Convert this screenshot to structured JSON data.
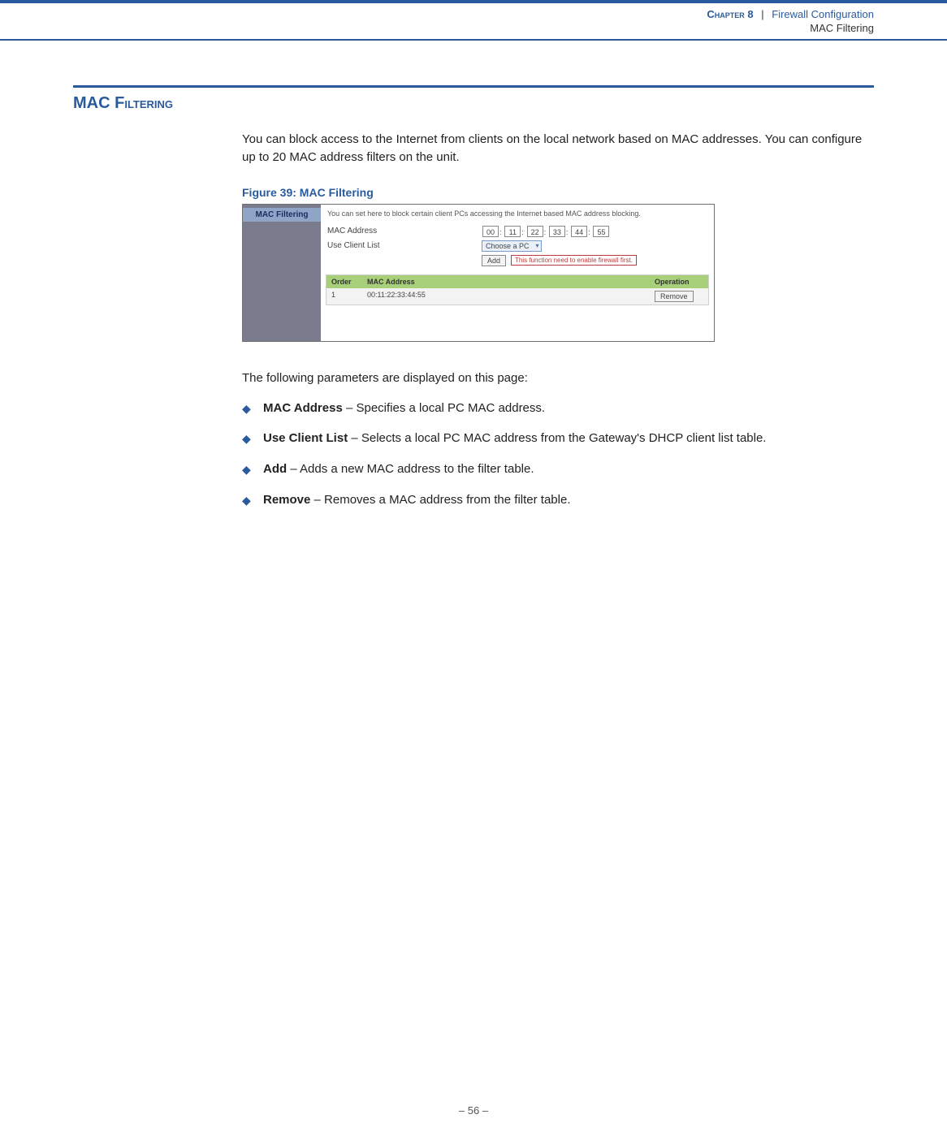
{
  "header": {
    "chapter_label": "Chapter 8",
    "separator": "|",
    "title": "Firewall Configuration",
    "subsection": "MAC Filtering"
  },
  "section": {
    "heading_main": "MAC F",
    "heading_rest": "iltering",
    "intro": "You can block access to the Internet from clients on the local network based on MAC addresses. You can configure up to 20 MAC address filters on the unit.",
    "figure_caption": "Figure 39:  MAC Filtering",
    "params_intro": "The following parameters are displayed on this page:",
    "params": [
      {
        "term": "MAC Address",
        "desc": " – Specifies a local PC MAC address."
      },
      {
        "term": "Use Client List",
        "desc": " – Selects a local PC MAC address from the Gateway's DHCP client list table."
      },
      {
        "term": "Add",
        "desc": " – Adds a new MAC address to the filter table."
      },
      {
        "term": "Remove",
        "desc": " – Removes a MAC address from the filter table."
      }
    ]
  },
  "screenshot": {
    "tab": "MAC Filtering",
    "desc": "You can set here to block certain client PCs accessing the Internet based MAC address blocking.",
    "label_mac": "MAC Address",
    "label_client": "Use Client List",
    "mac_octets": [
      "00",
      "11",
      "22",
      "33",
      "44",
      "55"
    ],
    "mac_sep": ":",
    "select_text": "Choose a PC",
    "add_btn": "Add",
    "warn": "This function need to enable firewall first.",
    "table": {
      "headers": {
        "order": "Order",
        "mac": "MAC Address",
        "op": "Operation"
      },
      "row": {
        "order": "1",
        "mac": "00:11:22:33:44:55",
        "remove": "Remove"
      }
    }
  },
  "footer": {
    "page": "–  56  –"
  }
}
